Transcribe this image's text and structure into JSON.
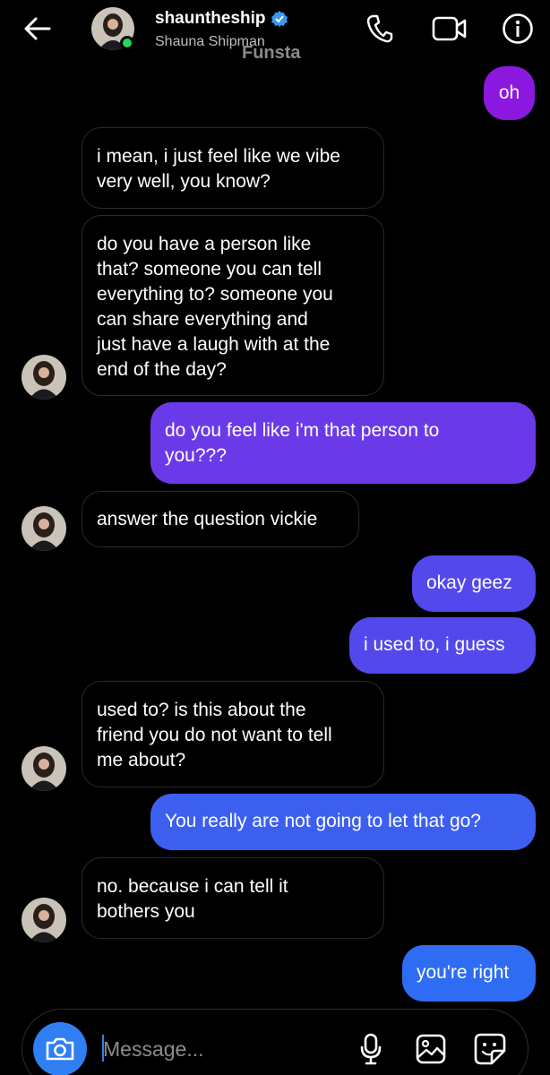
{
  "header": {
    "username": "shauntheship",
    "full_name": "Shauna Shipman",
    "watermark": "Funsta",
    "online_color": "#2fd158",
    "icons": [
      "back-arrow-icon",
      "phone-icon",
      "video-icon",
      "info-icon"
    ]
  },
  "messages": [
    {
      "from": "me",
      "text": "oh"
    },
    {
      "from": "them",
      "text": "i mean, i just feel like we vibe\nvery well, you know?"
    },
    {
      "from": "them",
      "text": "do you have  a person like\nthat? someone you can tell\neverything to? someone you\ncan share everything and\njust have a laugh with at the\nend of the day?"
    },
    {
      "from": "me",
      "text": "do you feel like i'm that person to\nyou???"
    },
    {
      "from": "them",
      "text": "answer the question vickie"
    },
    {
      "from": "me",
      "text": "okay geez"
    },
    {
      "from": "me",
      "text": "i used to, i guess"
    },
    {
      "from": "them",
      "text": "used to? is this about the\nfriend you do not want to tell\nme about?"
    },
    {
      "from": "me",
      "text": "You really are not going to let that go?"
    },
    {
      "from": "them",
      "text": "no. because i can tell it\nbothers you"
    },
    {
      "from": "me",
      "text": "you're right"
    }
  ],
  "composer": {
    "placeholder": "Message...",
    "icons": [
      "camera-icon",
      "microphone-icon",
      "gallery-icon",
      "sticker-icon"
    ]
  },
  "colors": {
    "sent_gradient_top": "#8c18e0",
    "sent_gradient_bottom": "#2e6df3",
    "camera_button": "#2f7ff2"
  }
}
